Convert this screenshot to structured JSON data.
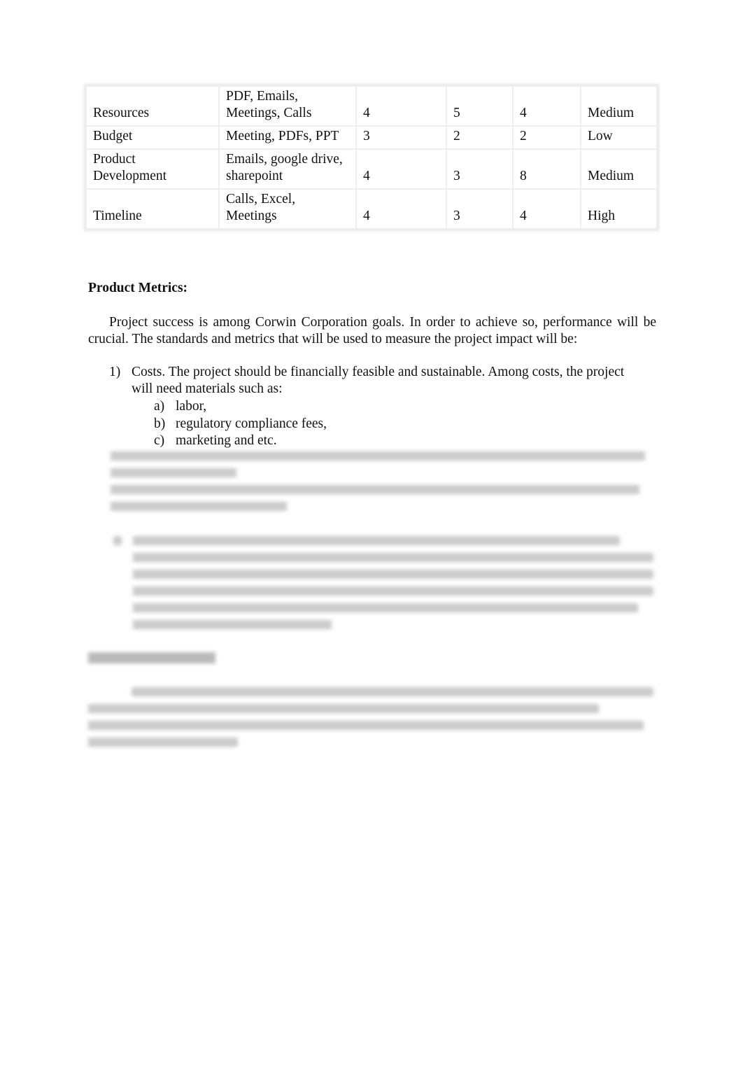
{
  "table": {
    "rows": [
      {
        "area": "Resources",
        "channels": [
          "PDF, Emails,",
          "Meetings, Calls"
        ],
        "c1": "4",
        "c2": "5",
        "c3": "4",
        "level": "Medium"
      },
      {
        "area": "Budget",
        "channels": [
          "Meeting, PDFs, PPT"
        ],
        "c1": "3",
        "c2": "2",
        "c3": "2",
        "level": "Low"
      },
      {
        "area": "Product Development",
        "channels": [
          "Emails, google drive,",
          "sharepoint"
        ],
        "c1": "4",
        "c2": "3",
        "c3": "8",
        "level": "Medium"
      },
      {
        "area": "Timeline",
        "channels": [
          "Calls, Excel,",
          "Meetings"
        ],
        "c1": "4",
        "c2": "3",
        "c3": "4",
        "level": "High"
      }
    ]
  },
  "section": {
    "heading": "Product Metrics:",
    "intro": "Project success is among Corwin Corporation goals. In order to achieve so, performance will be crucial. The standards and metrics that will be used to measure the project impact will be:",
    "item1_num": "1)",
    "item1_text": "Costs. The project should be financially feasible and sustainable. Among costs, the project will need materials such as:",
    "subitems": [
      {
        "m": "a)",
        "t": "labor,"
      },
      {
        "m": "b)",
        "t": "regulatory compliance fees,"
      },
      {
        "m": "c)",
        "t": "marketing and etc."
      }
    ]
  }
}
